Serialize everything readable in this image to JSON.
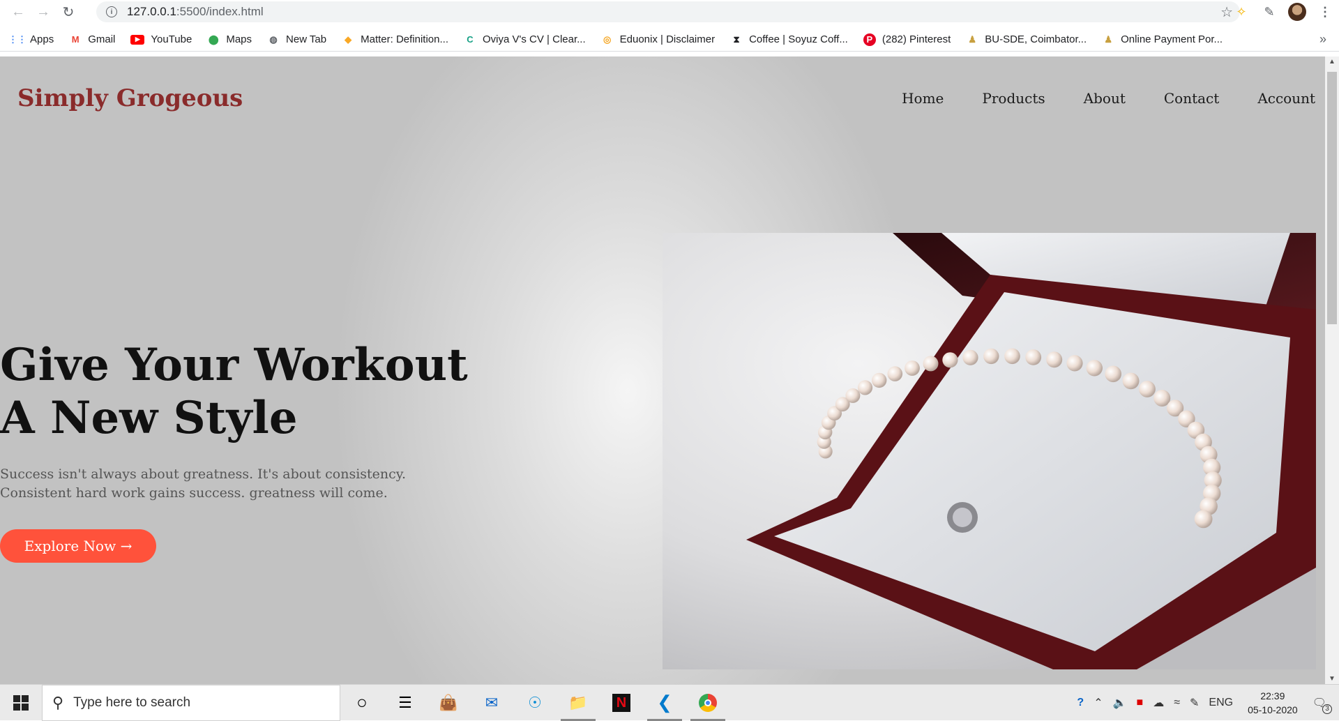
{
  "browser": {
    "url_host": "127.0.0.1",
    "url_path": ":5500/index.html",
    "bookmarks": [
      {
        "label": "Apps",
        "icon": "apps-grid-icon",
        "color": "#4285f4"
      },
      {
        "label": "Gmail",
        "icon": "gmail-icon",
        "color": "#ea4335"
      },
      {
        "label": "YouTube",
        "icon": "youtube-icon",
        "color": "#ff0000"
      },
      {
        "label": "Maps",
        "icon": "maps-pin-icon",
        "color": "#34a853"
      },
      {
        "label": "New Tab",
        "icon": "globe-icon",
        "color": "#5f6368"
      },
      {
        "label": "Matter: Definition...",
        "icon": "matter-icon",
        "color": "#f9a825"
      },
      {
        "label": "Oviya V's CV | Clear...",
        "icon": "c-logo-icon",
        "color": "#16a085"
      },
      {
        "label": "Eduonix | Disclaimer",
        "icon": "eduonix-icon",
        "color": "#f5a623"
      },
      {
        "label": "Coffee | Soyuz Coff...",
        "icon": "hourglass-icon",
        "color": "#202124"
      },
      {
        "label": "(282) Pinterest",
        "icon": "pinterest-icon",
        "color": "#e60023"
      },
      {
        "label": "BU-SDE, Coimbator...",
        "icon": "user-icon",
        "color": "#c8a040"
      },
      {
        "label": "Online Payment Por...",
        "icon": "user-icon",
        "color": "#c8a040"
      }
    ]
  },
  "site": {
    "logo": "Simply Grogeous",
    "nav": [
      "Home",
      "Products",
      "About",
      "Contact",
      "Account"
    ],
    "hero": {
      "title_line1": "Give Your Workout",
      "title_line2": "A New Style",
      "text": "Success isn't always about greatness. It's about consistency. Consistent hard work gains success. greatness will come.",
      "cta": "Explore Now →"
    },
    "image": "pearl-necklace-in-red-box"
  },
  "taskbar": {
    "search_placeholder": "Type here to search",
    "lang": "ENG",
    "time": "22:39",
    "date": "05-10-2020",
    "notif_count": "3"
  }
}
